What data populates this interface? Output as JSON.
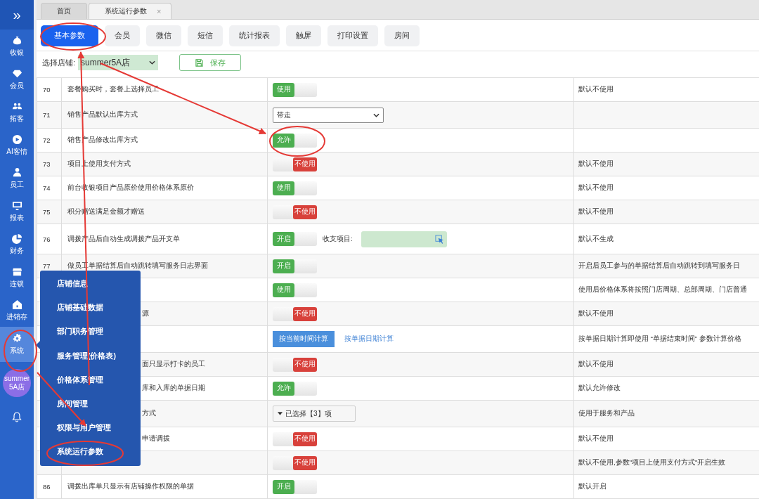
{
  "sidebar": {
    "toggle": "»",
    "items": [
      {
        "label": "收银",
        "selected": false
      },
      {
        "label": "会员",
        "selected": false
      },
      {
        "label": "拓客",
        "selected": false
      },
      {
        "label": "AI客情",
        "selected": false
      },
      {
        "label": "员工",
        "selected": false
      },
      {
        "label": "报表",
        "selected": false
      },
      {
        "label": "财务",
        "selected": false
      },
      {
        "label": "连锁",
        "selected": false
      },
      {
        "label": "进销存",
        "selected": false
      },
      {
        "label": "系统",
        "selected": true
      }
    ],
    "avatar": "summer5A店"
  },
  "tabs": [
    {
      "label": "首页",
      "selected": false
    },
    {
      "label": "系统运行参数",
      "selected": true,
      "close": "×"
    }
  ],
  "categories": [
    {
      "label": "基本参数",
      "selected": true
    },
    {
      "label": "会员",
      "selected": false
    },
    {
      "label": "微信",
      "selected": false
    },
    {
      "label": "短信",
      "selected": false
    },
    {
      "label": "统计报表",
      "selected": false
    },
    {
      "label": "触屏",
      "selected": false
    },
    {
      "label": "打印设置",
      "selected": false
    },
    {
      "label": "房间",
      "selected": false
    }
  ],
  "store": {
    "label": "选择店铺:",
    "value": "summer5A店"
  },
  "save_button": "保存",
  "rows": [
    {
      "no": "70",
      "name": "套餐购买时，套餐上选择员工",
      "kind": "toggle",
      "on": true,
      "label": "使用",
      "note": "默认不使用"
    },
    {
      "no": "71",
      "name": "销售产品默认出库方式",
      "kind": "select",
      "value": "带走"
    },
    {
      "no": "72",
      "name": "销售产品修改出库方式",
      "kind": "toggle",
      "on": true,
      "label": "允许"
    },
    {
      "no": "73",
      "name": "项目上使用支付方式",
      "kind": "toggle",
      "on": false,
      "label": "不使用",
      "note": "默认不使用"
    },
    {
      "no": "74",
      "name": "前台收银项目产品原价使用价格体系原价",
      "kind": "toggle",
      "on": true,
      "label": "使用",
      "note": "默认不使用"
    },
    {
      "no": "75",
      "name": "积分赠送满足金额才赠送",
      "kind": "toggle",
      "on": false,
      "label": "不使用",
      "note": "默认不使用"
    },
    {
      "no": "76",
      "name": "调拨产品后自动生成调拨产品开支单",
      "kind": "toggle_field",
      "on": true,
      "label": "开启",
      "field_label": "收支项目:",
      "note": "默认不生成"
    },
    {
      "no": "77",
      "name": "做员工单据结算后自动跳转填写服务日志界面",
      "kind": "toggle",
      "on": true,
      "label": "开启",
      "note": "开启后员工参与的单据结算后自动跳转到填写服务日"
    },
    {
      "kind": "toggle",
      "on": true,
      "label": "使用",
      "note": "使用后价格体系将按照门店周期、总部周期、门店普通"
    },
    {
      "name": "源",
      "kind": "toggle",
      "on": false,
      "label": "不使用",
      "note": "默认不使用"
    },
    {
      "kind": "choice",
      "options": [
        {
          "label": "按当前时间计算",
          "selected": true
        },
        {
          "label": "按单据日期计算",
          "selected": false
        }
      ],
      "note": "按单据日期计算即使用 “单据结束时间” 参数计算价格"
    },
    {
      "name": "面只显示打卡的员工",
      "kind": "toggle",
      "on": false,
      "label": "不使用",
      "note": "默认不使用"
    },
    {
      "name": "库和入库的单据日期",
      "kind": "toggle",
      "on": true,
      "label": "允许",
      "note": "默认允许修改"
    },
    {
      "name": "方式",
      "kind": "multiselect",
      "value": "已选择【3】项",
      "note": "使用于服务和产品"
    },
    {
      "name": "申请调拨",
      "kind": "toggle",
      "on": false,
      "label": "不使用",
      "note": "默认不使用"
    },
    {
      "kind": "toggle",
      "on": false,
      "label": "不使用",
      "note": "默认不使用,参数\"项目上使用支付方式\"开启生效"
    },
    {
      "no": "86",
      "name": "调拨出库单只显示有店铺操作权限的单据",
      "kind": "toggle",
      "on": true,
      "label": "开启",
      "note": "默认开启"
    }
  ],
  "menu": {
    "items": [
      {
        "label": "店铺信息"
      },
      {
        "label": "店铺基础数据"
      },
      {
        "label": "部门职务管理"
      },
      {
        "label": "服务管理(价格表)"
      },
      {
        "label": "价格体系管理"
      },
      {
        "label": "房间管理"
      },
      {
        "label": "权限与用户管理"
      },
      {
        "label": "系统运行参数"
      }
    ]
  }
}
